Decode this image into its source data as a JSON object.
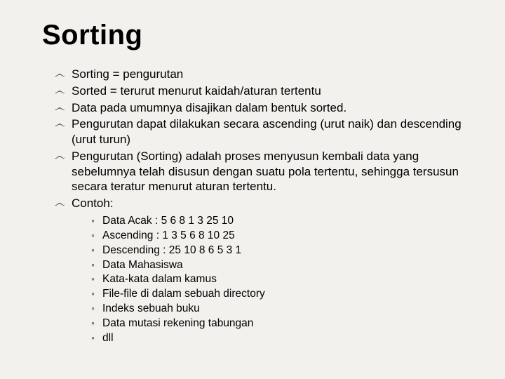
{
  "title": "Sorting",
  "bullets": [
    "Sorting = pengurutan",
    "Sorted = terurut menurut kaidah/aturan tertentu",
    "Data pada umumnya disajikan dalam bentuk sorted.",
    "Pengurutan dapat dilakukan secara ascending (urut naik) dan descending (urut turun)",
    "Pengurutan (Sorting) adalah proses menyusun kembali data yang sebelumnya telah disusun dengan suatu pola tertentu, sehingga tersusun secara teratur menurut aturan tertentu.",
    "Contoh:"
  ],
  "sub": [
    "Data Acak  : 5 6 8 1 3 25 10",
    "Ascending  : 1 3 5 6 8 10 25",
    "Descending            : 25 10 8 6 5 3 1",
    "Data Mahasiswa",
    "Kata-kata dalam kamus",
    "File-file di dalam sebuah directory",
    "Indeks sebuah buku",
    "Data mutasi rekening tabungan",
    "dll"
  ],
  "bullet_glyph": "෴"
}
